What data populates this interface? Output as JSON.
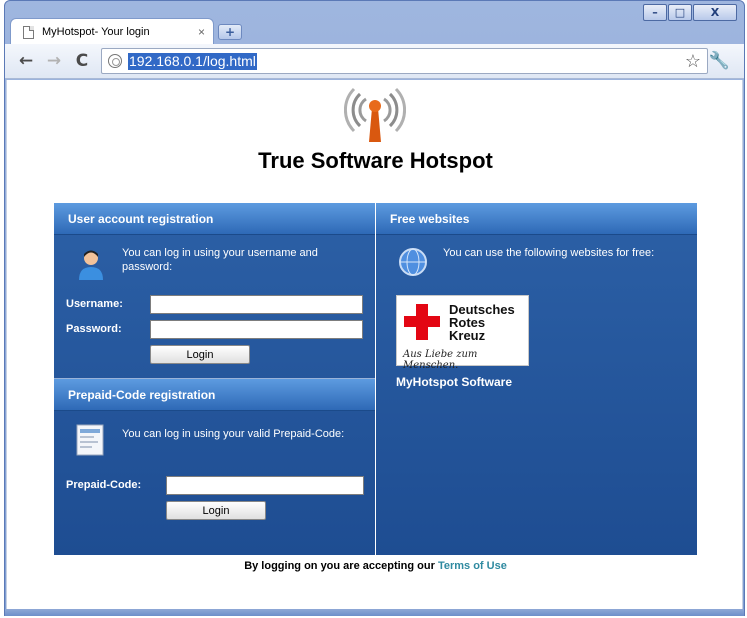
{
  "browser": {
    "tab_title": "MyHotspot- Your login",
    "tab_close": "×",
    "new_tab": "+",
    "url": "192.168.0.1/log.html",
    "win_minimize": "–",
    "win_maximize": "□",
    "win_close": "X",
    "back": "←",
    "forward": "→",
    "reload": "C",
    "star": "☆",
    "wrench": "🔧"
  },
  "page": {
    "title": "True Software Hotspot",
    "left_panel": {
      "account_header": "User account registration",
      "account_info": "You can log in using your username and password:",
      "username_label": "Username:",
      "password_label": "Password:",
      "username_value": "",
      "password_value": "",
      "login_label": "Login",
      "prepaid_header": "Prepaid-Code registration",
      "prepaid_info": "You can log in using your valid Prepaid-Code:",
      "prepaid_label": "Prepaid-Code:",
      "prepaid_value": "",
      "prepaid_login_label": "Login"
    },
    "right_panel": {
      "header": "Free websites",
      "info": "You can use the following websites for free:",
      "drk_line1": "Deutsches",
      "drk_line2": "Rotes",
      "drk_line3": "Kreuz",
      "drk_slogan": "Aus Liebe zum Menschen.",
      "site_name": "MyHotspot Software"
    },
    "footer_text": "By logging on you are accepting our ",
    "footer_link": "Terms of Use"
  },
  "colors": {
    "panel_blue": "#1e4d92",
    "header_blue": "#5d9be0",
    "link_teal": "#2f8aa0",
    "drk_red": "#e30613"
  }
}
